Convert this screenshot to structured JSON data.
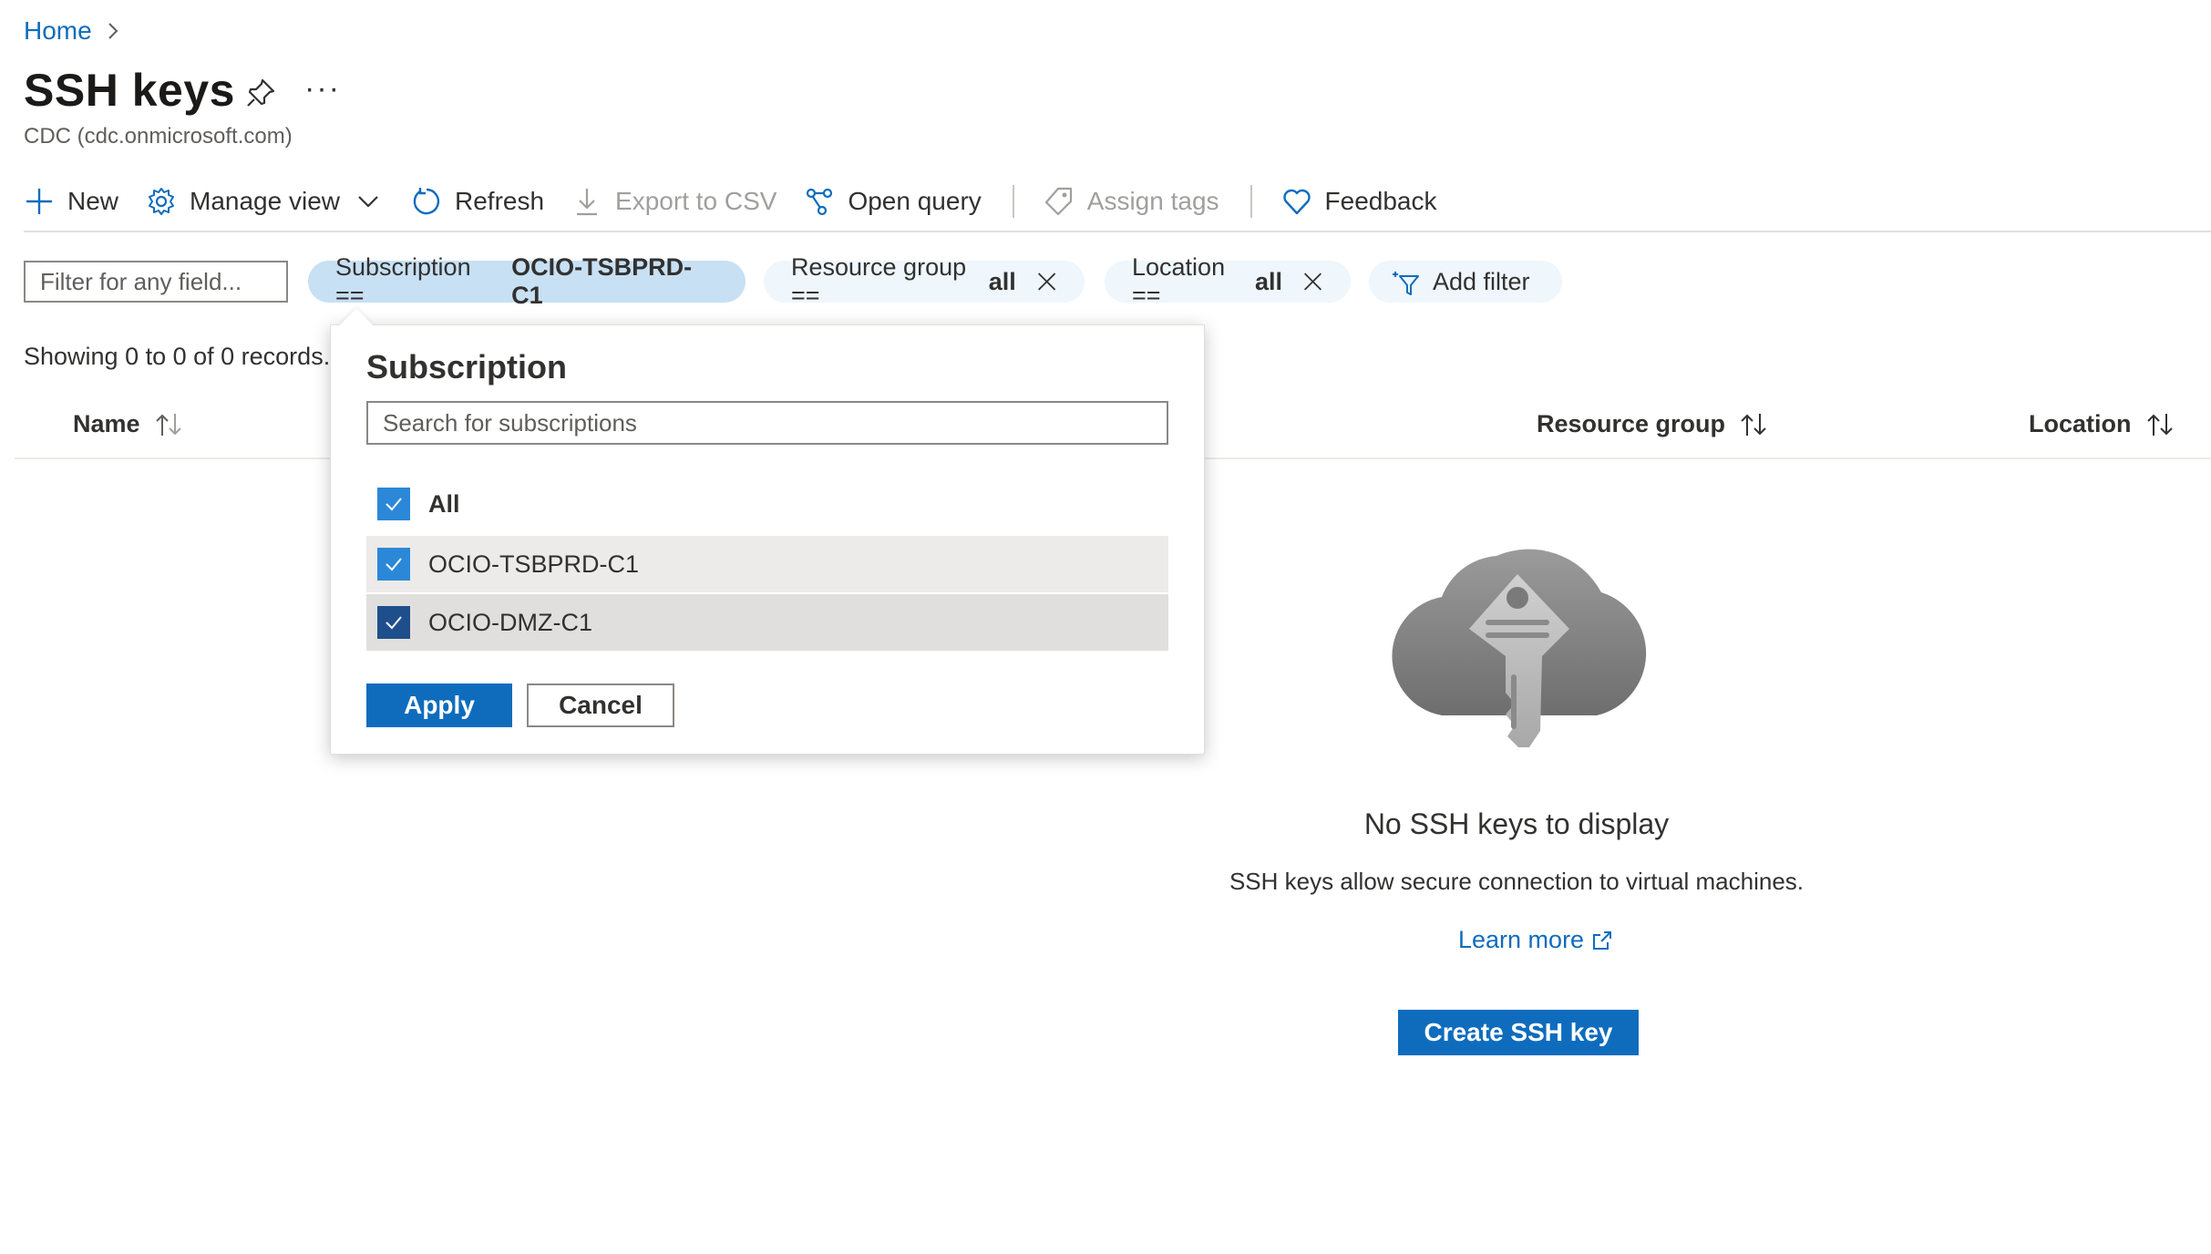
{
  "breadcrumb": {
    "home": "Home"
  },
  "page": {
    "title": "SSH keys",
    "subtitle": "CDC (cdc.onmicrosoft.com)",
    "more": "···"
  },
  "toolbar": {
    "new": "New",
    "manage_view": "Manage view",
    "refresh": "Refresh",
    "export_csv": "Export to CSV",
    "open_query": "Open query",
    "assign_tags": "Assign tags",
    "feedback": "Feedback"
  },
  "filters": {
    "placeholder": "Filter for any field...",
    "subscription": {
      "label": "Subscription ==",
      "value": "OCIO-TSBPRD-C1"
    },
    "resource_group": {
      "label": "Resource group ==",
      "value": "all"
    },
    "location": {
      "label": "Location ==",
      "value": "all"
    },
    "add_filter": "Add filter"
  },
  "records_text": "Showing 0 to 0 of 0 records.",
  "columns": {
    "name": "Name",
    "resource_group": "Resource group",
    "location": "Location"
  },
  "empty_state": {
    "title": "No SSH keys to display",
    "description": "SSH keys allow secure connection to virtual machines.",
    "learn_more": "Learn more",
    "create_button": "Create SSH key"
  },
  "subscription_panel": {
    "title": "Subscription",
    "search_placeholder": "Search for subscriptions",
    "options": [
      {
        "label": "All",
        "checked": true
      },
      {
        "label": "OCIO-TSBPRD-C1",
        "checked": true
      },
      {
        "label": "OCIO-DMZ-C1",
        "checked": true
      }
    ],
    "apply": "Apply",
    "cancel": "Cancel"
  },
  "colors": {
    "accent": "#0f6cbd",
    "pill_active": "#c7e0f4",
    "pill": "#eff6fc"
  }
}
